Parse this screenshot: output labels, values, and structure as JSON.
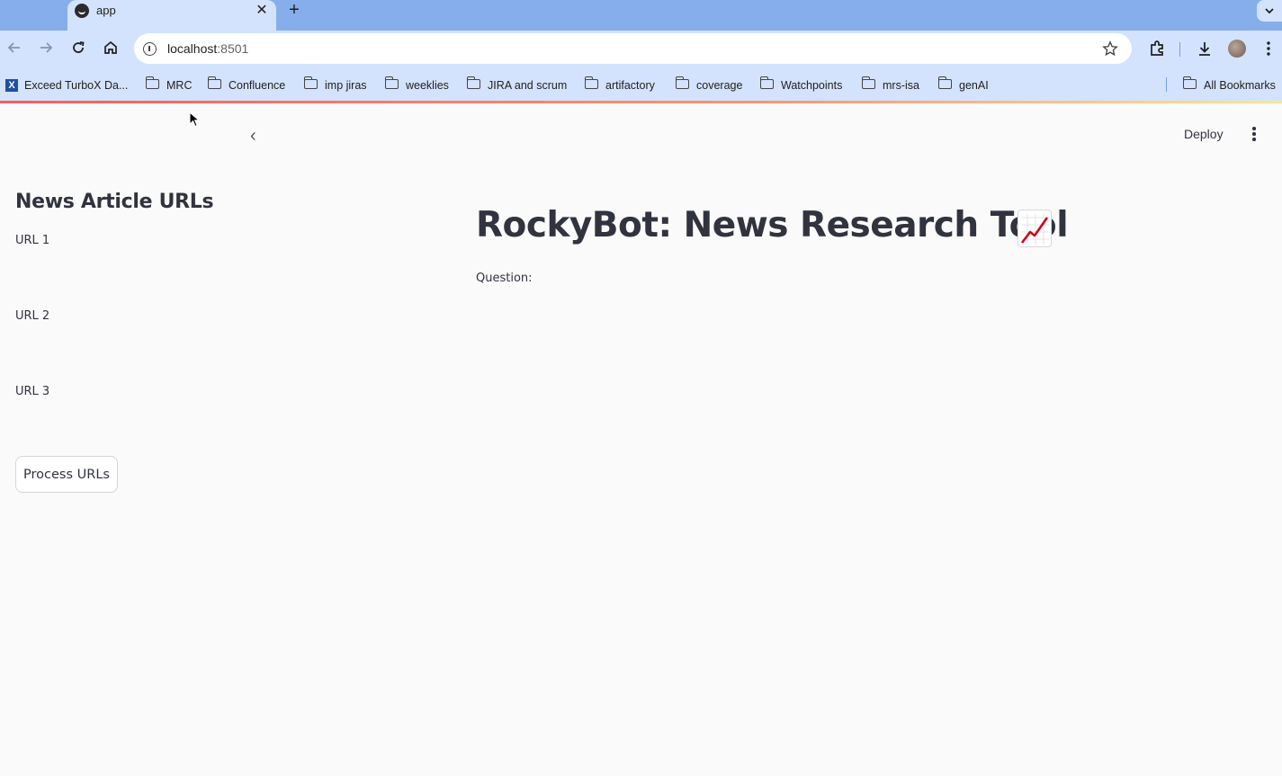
{
  "browser": {
    "tab": {
      "title": "app",
      "close_glyph": "✕"
    },
    "new_tab_glyph": "+",
    "address": {
      "host": "localhost",
      "port": ":8501"
    },
    "bookmarks": [
      {
        "label": "Exceed TurboX Da...",
        "icon": "x-app-icon"
      },
      {
        "label": "MRC",
        "icon": "folder-icon"
      },
      {
        "label": "Confluence",
        "icon": "folder-icon"
      },
      {
        "label": "imp jiras",
        "icon": "folder-icon"
      },
      {
        "label": "weeklies",
        "icon": "folder-icon"
      },
      {
        "label": "JIRA and scrum",
        "icon": "folder-icon"
      },
      {
        "label": "artifactory",
        "icon": "folder-icon"
      },
      {
        "label": "coverage",
        "icon": "folder-icon"
      },
      {
        "label": "Watchpoints",
        "icon": "folder-icon"
      },
      {
        "label": "mrs-isa",
        "icon": "folder-icon"
      },
      {
        "label": "genAI",
        "icon": "folder-icon"
      }
    ],
    "all_bookmarks_label": "All Bookmarks"
  },
  "app": {
    "deploy_label": "Deploy",
    "collapse_glyph": "‹",
    "sidebar": {
      "title": "News Article URLs",
      "url_labels": [
        "URL 1",
        "URL 2",
        "URL 3"
      ],
      "url_values": [
        "",
        "",
        ""
      ],
      "process_button": "Process URLs"
    },
    "main": {
      "title": "RockyBot: News Research Tool",
      "title_icon": "chart-increasing-icon",
      "question_label": "Question:",
      "question_value": ""
    }
  },
  "colors": {
    "tab_bar": "#86aeea",
    "toolbar": "#d3e3fd",
    "page_bg": "#fafafa",
    "text": "#31333f",
    "accent": "#ff4b4b"
  }
}
